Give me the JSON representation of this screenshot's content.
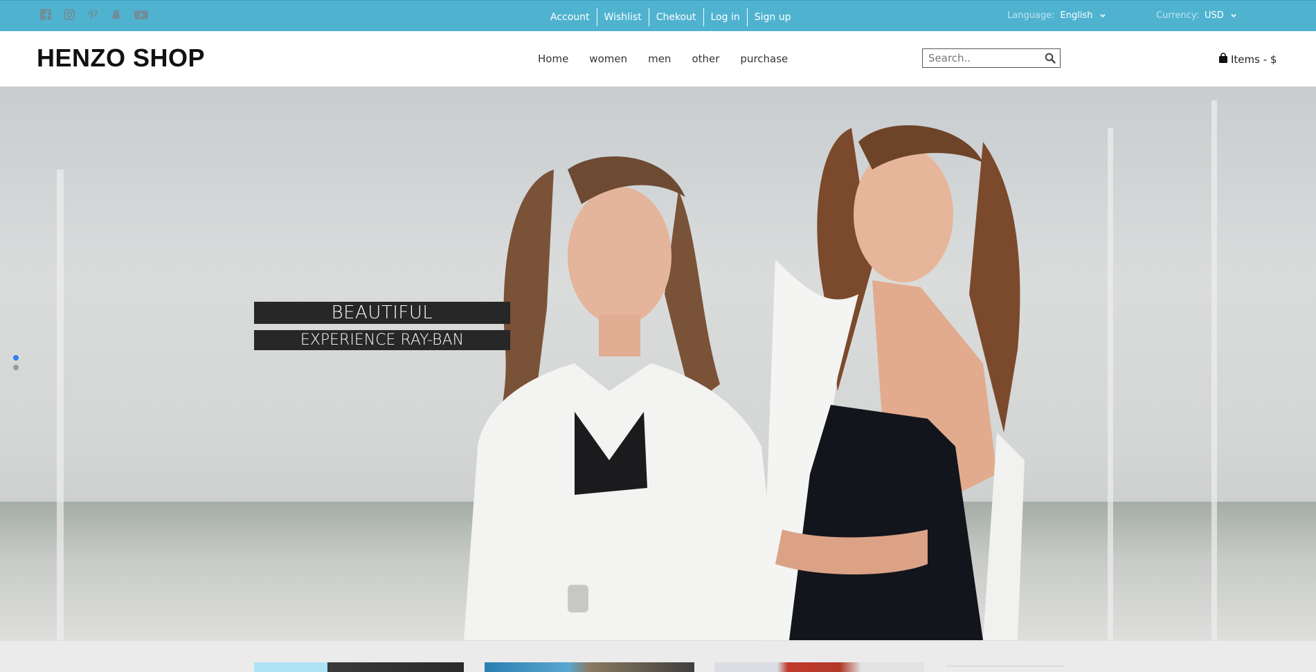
{
  "topbar": {
    "social": [
      "facebook-icon",
      "instagram-icon",
      "pinterest-icon",
      "snapchat-icon",
      "youtube-icon"
    ],
    "links": [
      "Account",
      "Wishlist",
      "Chekout",
      "Log in",
      "Sign up"
    ],
    "language": {
      "label": "Language:",
      "value": "English"
    },
    "currency": {
      "label": "Currency:",
      "value": "USD"
    },
    "bg_color": "#4fb3d0"
  },
  "header": {
    "logo": "HENZO SHOP",
    "nav": [
      "Home",
      "women",
      "men",
      "other",
      "purchase"
    ],
    "search_placeholder": "Search..",
    "cart_label": "Items - $"
  },
  "hero": {
    "caption_line1": "BEAUTIFUL",
    "caption_line2": "EXPERIENCE RAY-BAN",
    "slides": 2,
    "active_slide": 1,
    "image_description_icon": "hero-image"
  }
}
